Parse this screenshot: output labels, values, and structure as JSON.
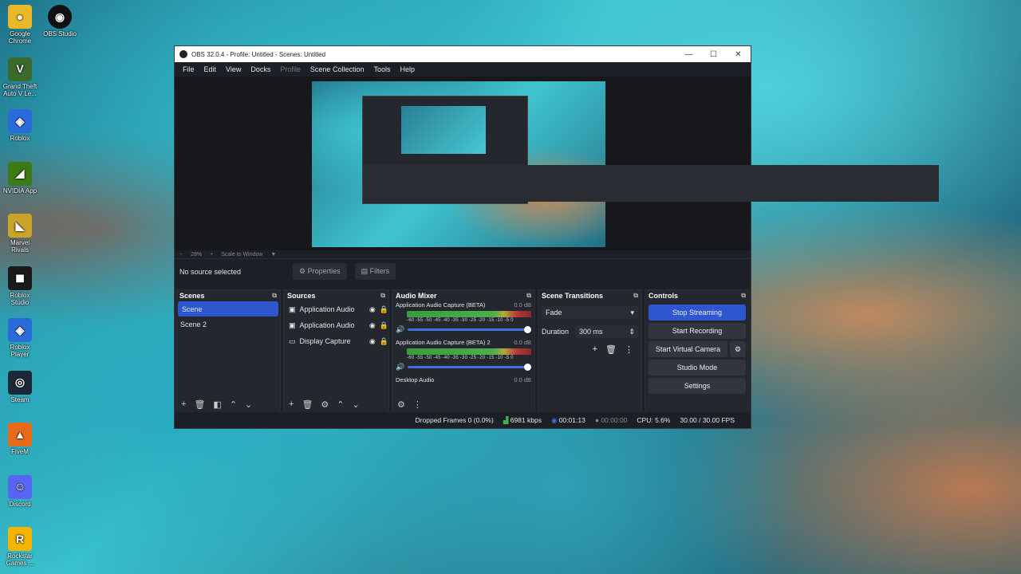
{
  "desktop": {
    "icons": [
      {
        "label": "Google Chrome",
        "color": "#e9b82a",
        "glyph": "●"
      },
      {
        "label": "Grand Theft Auto V Le...",
        "color": "#3a6b2a",
        "glyph": "V"
      },
      {
        "label": "Roblox",
        "color": "#2a6bdc",
        "glyph": "◈"
      },
      {
        "label": "NVIDIA App",
        "color": "#3b7a14",
        "glyph": "◢"
      },
      {
        "label": "Marvel Rivals",
        "color": "#c9a42a",
        "glyph": "◣"
      },
      {
        "label": "Roblox Studio",
        "color": "#1a1a1a",
        "glyph": "◼"
      },
      {
        "label": "Roblox Player",
        "color": "#2a6bdc",
        "glyph": "◈"
      },
      {
        "label": "Steam",
        "color": "#1b2838",
        "glyph": "◎"
      },
      {
        "label": "FiveM",
        "color": "#e56a1a",
        "glyph": "▲"
      },
      {
        "label": "Discord",
        "color": "#5865f2",
        "glyph": "☺"
      },
      {
        "label": "Rockstar Games ...",
        "color": "#f4b400",
        "glyph": "R"
      }
    ],
    "obs_icon_label": "OBS Studio"
  },
  "window": {
    "title": "OBS 32.0.4 - Profile: Untitled - Scenes: Untitled",
    "minimize": "—",
    "maximize": "☐",
    "close": "✕"
  },
  "menu": [
    "File",
    "Edit",
    "View",
    "Docks",
    "Profile",
    "Scene Collection",
    "Tools",
    "Help"
  ],
  "zoom": {
    "minus": "−",
    "level": "28%",
    "plus": "+",
    "mode": "Scale to Window"
  },
  "source_bar": {
    "no_source": "No source selected",
    "properties": "Properties",
    "filters": "Filters"
  },
  "scenes": {
    "title": "Scenes",
    "items": [
      "Scene",
      "Scene 2"
    ],
    "selected": 0
  },
  "sources": {
    "title": "Sources",
    "items": [
      "Application Audio",
      "Application Audio",
      "Display Capture"
    ]
  },
  "mixer": {
    "title": "Audio Mixer",
    "channels": [
      {
        "name": "Application Audio Capture (BETA)",
        "db": "0.0 dB"
      },
      {
        "name": "Application Audio Capture (BETA) 2",
        "db": "0.0 dB"
      },
      {
        "name": "Desktop Audio",
        "db": "0.0 dB"
      }
    ],
    "ticks": "-60 -55 -50 -45 -40 -35 -30 -25 -20 -15 -10 -5 0"
  },
  "transitions": {
    "title": "Scene Transitions",
    "type": "Fade",
    "duration_label": "Duration",
    "duration": "300 ms"
  },
  "controls": {
    "title": "Controls",
    "stream": "Stop Streaming",
    "record": "Start Recording",
    "virtual_cam": "Start Virtual Camera",
    "studio": "Studio Mode",
    "settings": "Settings"
  },
  "status": {
    "dropped": "Dropped Frames 0 (0.0%)",
    "bitrate": "6981 kbps",
    "stream_time": "00:01:13",
    "rec_time": "00:00:00",
    "cpu": "CPU: 5.6%",
    "fps": "30.00 / 30.00 FPS"
  }
}
